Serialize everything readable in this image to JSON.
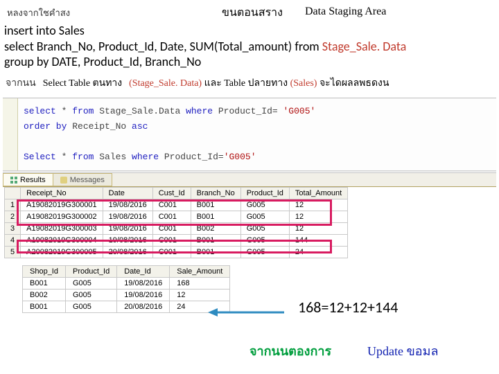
{
  "header": {
    "left": "หลงจากใชคำสง",
    "mid": "ขนตอนสราง",
    "right": "Data Staging Area"
  },
  "sql": {
    "l1": "insert into Sales",
    "l2a": "select Branch_No, Product_Id, Date, SUM(Total_amount) from ",
    "l2b": "Stage_Sale. Data",
    "l3": "group by DATE, Product_Id, Branch_No"
  },
  "line2": {
    "lab": "จากนน",
    "sel": "Select Table ตนทาง",
    "p1": "(Stage_Sale. Data)",
    "mid": " และ Table ปลายทาง ",
    "p2": "(Sales)",
    "rest": " จะไดผลลพธดงน"
  },
  "pane": {
    "q1a": "select * from Stage_Sale.Data where Product_Id= ",
    "q1b": "'G005'",
    "q2": "order by Receipt_No asc",
    "q3a": "Select * from Sales where Product_Id=",
    "q3b": "'G005'"
  },
  "tabs": {
    "results": "Results",
    "messages": "Messages"
  },
  "table1": {
    "cols": [
      "",
      "Receipt_No",
      "Date",
      "Cust_Id",
      "Branch_No",
      "Product_Id",
      "Total_Amount"
    ],
    "rows": [
      [
        "1",
        "A19082019G300001",
        "19/08/2016",
        "C001",
        "B001",
        "G005",
        "12"
      ],
      [
        "2",
        "A19082019G300002",
        "19/08/2016",
        "C001",
        "B001",
        "G005",
        "12"
      ],
      [
        "3",
        "A19082019G300003",
        "19/08/2016",
        "C001",
        "B002",
        "G005",
        "12"
      ],
      [
        "4",
        "A19082019G300004",
        "19/08/2016",
        "C001",
        "B001",
        "G005",
        "144"
      ],
      [
        "5",
        "A20082019G300005",
        "20/08/2016",
        "C001",
        "B001",
        "G005",
        "24"
      ]
    ]
  },
  "table2": {
    "cols": [
      "Shop_Id",
      "Product_Id",
      "Date_Id",
      "Sale_Amount"
    ],
    "rows": [
      [
        "B001",
        "G005",
        "19/08/2016",
        "168"
      ],
      [
        "B002",
        "G005",
        "19/08/2016",
        "12"
      ],
      [
        "B001",
        "G005",
        "20/08/2016",
        "24"
      ]
    ]
  },
  "sum": "168=12+12+144",
  "foot1": "จากนนตองการ",
  "foot2": "Update ขอมล"
}
